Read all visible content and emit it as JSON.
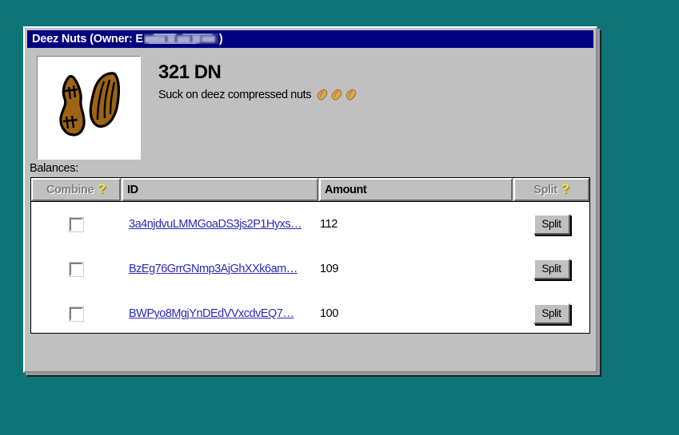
{
  "window": {
    "title_prefix": "Deez Nuts (Owner: E",
    "title_suffix": ")",
    "owner_redacted": true
  },
  "asset": {
    "title": "321 DN",
    "description": "Suck on deez compressed nuts",
    "description_emoji": "🥜🥜🥜",
    "thumbnail_name": "two-peanuts-drawing"
  },
  "balances": {
    "section_label": "Balances:",
    "columns": {
      "combine": "Combine",
      "id": "ID",
      "amount": "Amount",
      "split": "Split"
    },
    "help_glyph": "?",
    "row_action_label": "Split",
    "rows": [
      {
        "id": "3a4njdvuLMMGoaDS3js2P1Hyxs…",
        "amount": "112",
        "checked": false
      },
      {
        "id": "BzEg76GrrGNmp3AjGhXXk6am…",
        "amount": "109",
        "checked": false
      },
      {
        "id": "BWPyo8MgjYnDEdVVxcdvEQ7…",
        "amount": "100",
        "checked": false
      }
    ]
  },
  "colors": {
    "desktop": "#0e7377",
    "window_face": "#c0c0c0",
    "titlebar": "#000080",
    "link": "#2a2ab8",
    "help_icon": "#f2e33a",
    "peanut_body": "#9c6415"
  }
}
